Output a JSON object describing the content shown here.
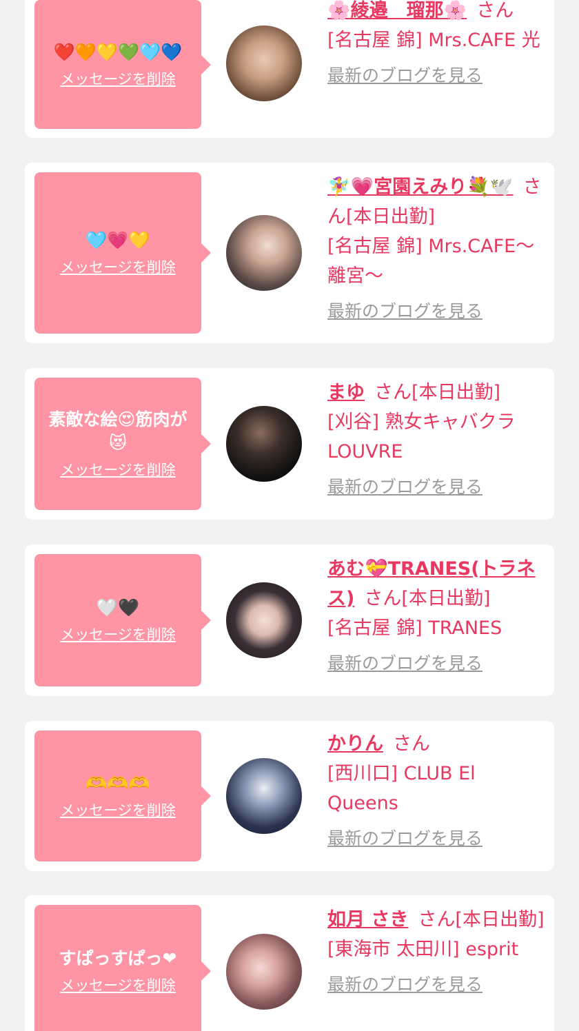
{
  "colors": {
    "accent": "#e8385f",
    "bubble": "#ff95a4",
    "muted": "#9a9a9a",
    "background": "#f2f2f2"
  },
  "delete_label": "メッセージを削除",
  "blog_label": "最新のブログを見る",
  "san_label": "さん",
  "items": [
    {
      "message": "❤️🧡💛💚🩵💙",
      "name": "🌸綾邉　瑠那🌸",
      "status": "",
      "shop": "[名古屋 錦] Mrs.CAFE 光"
    },
    {
      "message": "🩵💗💛",
      "name": "🧚‍♀️💗宮園えみり💐🕊️",
      "status": "[本日出勤]",
      "shop": "[名古屋 錦] Mrs.CAFE〜離宮〜"
    },
    {
      "message": "素敵な絵😍筋肉が😻",
      "name": "まゆ",
      "status": "[本日出勤]",
      "shop": "[刈谷] 熟女キャバクラ LOUVRE"
    },
    {
      "message": "🤍🖤",
      "name": "あむ💝TRANES(トラネス)",
      "status": "[本日出勤]",
      "shop": "[名古屋 錦] TRANES"
    },
    {
      "message": "🫶🫶🫶",
      "name": "かりん",
      "status": "",
      "shop": "[西川口] CLUB El Queens"
    },
    {
      "message": "すぱっすぱっ❤︎",
      "name": "如月 さき",
      "status": "[本日出勤]",
      "shop": "[東海市 太田川] esprit"
    }
  ]
}
